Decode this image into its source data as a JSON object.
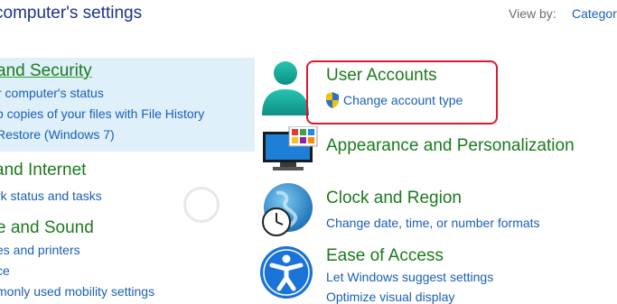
{
  "header": {
    "title": "computer's settings",
    "view_by_label": "View by:",
    "view_by_value": "Category"
  },
  "left_column": {
    "security": {
      "heading": "and Security",
      "links": [
        "r computer's status",
        "p copies of your files with File History",
        " Restore (Windows 7)"
      ]
    },
    "network": {
      "heading": " and Internet",
      "links": [
        "rk status and tasks"
      ]
    },
    "hardware": {
      "heading": "e and Sound",
      "links": [
        "es and printers",
        "ce",
        "monly used mobility settings"
      ]
    }
  },
  "right_column": {
    "user_accounts": {
      "heading": "User Accounts",
      "link": "Change account type"
    },
    "appearance": {
      "heading": "Appearance and Personalization"
    },
    "clock": {
      "heading": "Clock and Region",
      "link": "Change date, time, or number formats"
    },
    "ease": {
      "heading": "Ease of Access",
      "links": [
        "Let Windows suggest settings",
        "Optimize visual display"
      ]
    }
  },
  "colors": {
    "heading_green": "#1d7a1d",
    "link_blue": "#1a5fb4",
    "highlight_bg": "#dff0fb",
    "annotation_red": "#e0182d"
  },
  "icons": {
    "user_accounts": "user-accounts-icon",
    "appearance": "monitor-appearance-icon",
    "clock": "globe-clock-icon",
    "ease": "ease-of-access-icon",
    "shield": "uac-shield-icon"
  }
}
